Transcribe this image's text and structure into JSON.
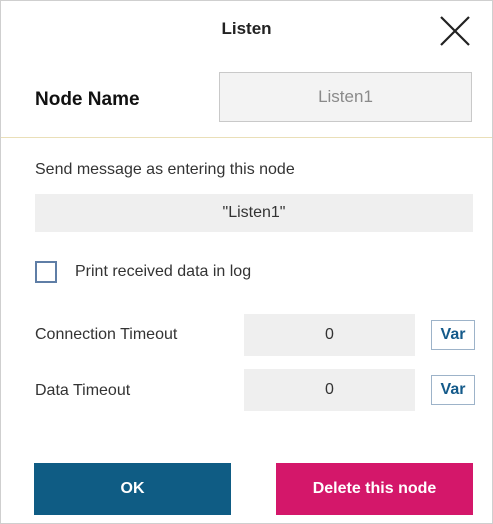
{
  "dialog": {
    "title": "Listen",
    "close_icon": "close-icon"
  },
  "node_name": {
    "label": "Node Name",
    "value": "Listen1"
  },
  "send_message": {
    "label": "Send message as entering this node",
    "value": "\"Listen1\""
  },
  "print_log": {
    "label": "Print received data in log",
    "checked": false
  },
  "connection_timeout": {
    "label": "Connection Timeout",
    "value": "0",
    "var_label": "Var"
  },
  "data_timeout": {
    "label": "Data Timeout",
    "value": "0",
    "var_label": "Var"
  },
  "buttons": {
    "ok": "OK",
    "delete": "Delete this node"
  },
  "colors": {
    "ok_button": "#0f5c84",
    "delete_button": "#d4176a",
    "var_text": "#145a8a",
    "checkbox_border": "#5f7ea6"
  }
}
